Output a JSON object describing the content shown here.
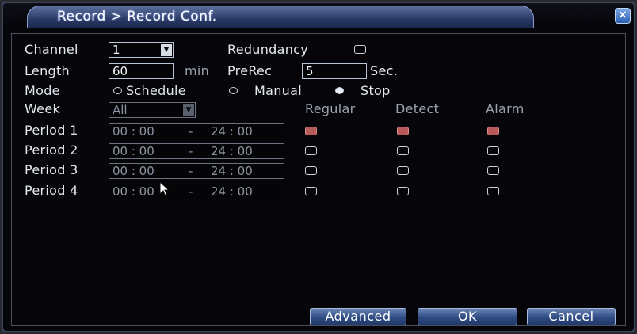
{
  "dialog": {
    "title": "Record > Record Conf.",
    "close_glyph": "×"
  },
  "form": {
    "channel_label": "Channel",
    "channel_value": "1",
    "redundancy_label": "Redundancy",
    "redundancy_checked": false,
    "length_label": "Length",
    "length_value": "60",
    "length_unit": "min",
    "prerec_label": "PreRec",
    "prerec_value": "5",
    "prerec_unit": "Sec.",
    "mode_label": "Mode",
    "mode_options": [
      "Schedule",
      "Manual",
      "Stop"
    ],
    "mode_selected": "Stop",
    "week_label": "Week",
    "week_value": "All",
    "col_regular": "Regular",
    "col_detect": "Detect",
    "col_alarm": "Alarm",
    "sep": "-",
    "periods": [
      {
        "label": "Period 1",
        "start": "00 : 00",
        "end": "24 : 00",
        "regular": true,
        "detect": true,
        "alarm": true
      },
      {
        "label": "Period 2",
        "start": "00 : 00",
        "end": "24 : 00",
        "regular": false,
        "detect": false,
        "alarm": false
      },
      {
        "label": "Period 3",
        "start": "00 : 00",
        "end": "24 : 00",
        "regular": false,
        "detect": false,
        "alarm": false
      },
      {
        "label": "Period 4",
        "start": "00 : 00",
        "end": "24 : 00",
        "regular": false,
        "detect": false,
        "alarm": false
      }
    ]
  },
  "buttons": {
    "advanced": "Advanced",
    "ok": "OK",
    "cancel": "Cancel"
  },
  "icons": {
    "dropdown": "chevron-down-icon",
    "close": "close-icon",
    "cursor": "mouse-pointer-icon"
  },
  "colors": {
    "background": "#06060a",
    "accent": "#2f4c84",
    "checked": "#b85a5a"
  }
}
